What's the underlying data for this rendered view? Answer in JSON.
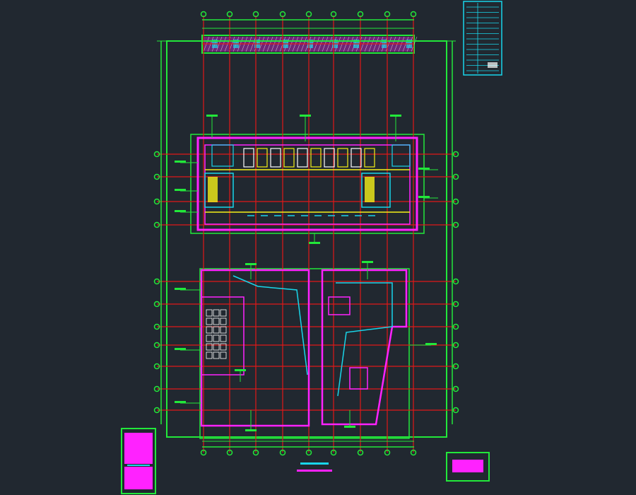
{
  "viewport": {
    "background": "#212830"
  },
  "colors": {
    "grid": "#e01818",
    "outline": "#22e83a",
    "walls": "#ff22ff",
    "cyan": "#19d6ea",
    "yellow": "#f5f018",
    "white": "#ffffff"
  },
  "title_block": {
    "color": "#19d6ea",
    "icon": "legend-table-icon"
  },
  "drawing": {
    "icon": "floor-plan-icon",
    "grid_axis_bubbles": "grid-axis-bubble-icon"
  }
}
